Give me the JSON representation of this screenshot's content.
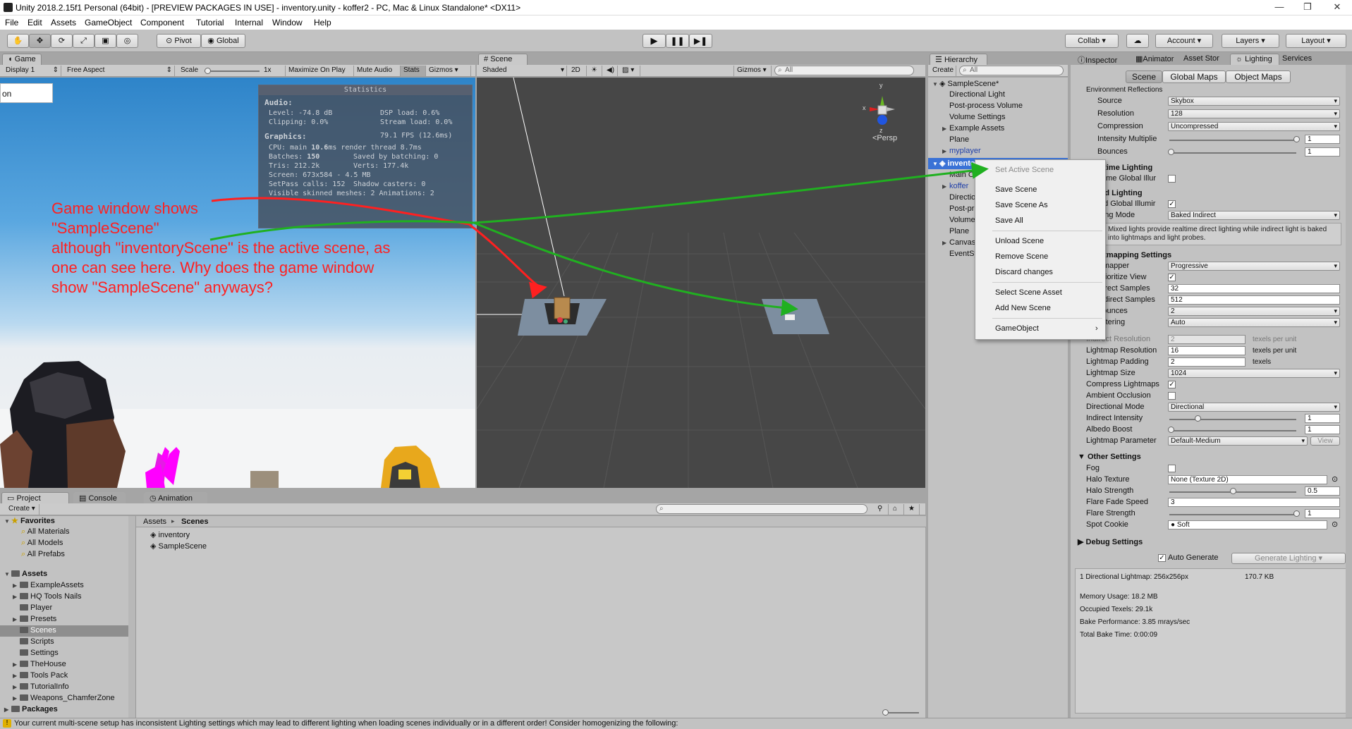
{
  "window": {
    "title": "Unity 2018.2.15f1 Personal (64bit) - [PREVIEW PACKAGES IN USE] - inventory.unity - koffer2 - PC, Mac & Linux Standalone* <DX11>",
    "minimize": "—",
    "maximize": "❐",
    "close": "✕"
  },
  "menu": [
    "File",
    "Edit",
    "Assets",
    "GameObject",
    "Component",
    "Tutorial",
    "Internal",
    "Window",
    "Help"
  ],
  "toolbar": {
    "pivot": "Pivot",
    "global": "Global",
    "collab": "Collab ▾",
    "account": "Account",
    "layers": "Layers",
    "layout": "Layout"
  },
  "game": {
    "tab": "Game",
    "display": "Display 1",
    "aspect": "Free Aspect",
    "scale_label": "Scale",
    "scale_value": "1x",
    "maximize": "Maximize On Play",
    "mute": "Mute Audio",
    "stats": "Stats",
    "gizmos": "Gizmos",
    "input_text": "on",
    "stats_title": "Statistics",
    "audio_header": "Audio:",
    "level": "Level: -74.8 dB",
    "dsp": "DSP load: 0.6%",
    "clipping": "Clipping: 0.0%",
    "stream": "Stream load: 0.0%",
    "graphics_header": "Graphics:",
    "fps": "79.1 FPS (12.6ms)",
    "cpu_prefix": "CPU: main ",
    "cpu_main": "10.6",
    "cpu_suffix": "ms  render thread 8.7ms",
    "batches_prefix": "Batches: ",
    "batches": "150",
    "saved": "Saved by batching: 0",
    "tris": "Tris: 212.2k",
    "verts": "Verts: 177.4k",
    "screen": "Screen: 673x584 - 4.5 MB",
    "setpass": "SetPass calls: 152",
    "shadow": "Shadow casters: 0",
    "visible": "Visible skinned meshes: 2   Animations: 2"
  },
  "annotation": {
    "line1": "Game window shows",
    "line2": "\"SampleScene\"",
    "line3": "although \"inventoryScene\" is the active scene, as",
    "line4": "one can see here. Why does the game window",
    "line5": "show \"SampleScene\" anyways?",
    "color": "#ff2020"
  },
  "scene": {
    "tab": "Scene",
    "shaded": "Shaded",
    "mode_2d": "2D",
    "gizmos": "Gizmos",
    "search": "All",
    "persp": "<Persp",
    "axis_y": "y",
    "axis_x": "x",
    "axis_z": "z"
  },
  "hierarchy": {
    "tab": "Hierarchy",
    "create": "Create",
    "search": "All",
    "sample_scene": "SampleScene*",
    "sample_items": [
      "Directional Light",
      "Post-process Volume",
      "Volume Settings",
      "Example Assets",
      "Plane",
      "myplayer"
    ],
    "inventory_scene": "inventoryScene",
    "inventory_items": [
      "Main Camera",
      "koffer",
      "Directional Light",
      "Post-process Volume",
      "Volume Settings",
      "Plane",
      "Canvas",
      "EventSystem"
    ]
  },
  "context_menu": {
    "items": [
      "Set Active Scene",
      "Save Scene",
      "Save Scene As",
      "Save All",
      "Unload Scene",
      "Remove Scene",
      "Discard changes",
      "Select Scene Asset",
      "Add New Scene",
      "GameObject"
    ]
  },
  "right_tabs": [
    "Inspector",
    "Animator",
    "Asset Stor",
    "Lighting",
    "Services"
  ],
  "lighting": {
    "subtabs": [
      "Scene",
      "Global Maps",
      "Object Maps"
    ],
    "env_reflections": "Environment Reflections",
    "source_label": "Source",
    "source_value": "Skybox",
    "resolution_label": "Resolution",
    "resolution_value": "128",
    "compression_label": "Compression",
    "compression_value": "Uncompressed",
    "intensity_mult_label": "Intensity Multiplie",
    "intensity_mult_value": "1",
    "bounces_label": "Bounces",
    "bounces_value": "1",
    "realtime_header": "Realtime Lighting",
    "realtime_gi_label": "Realtime Global Illur",
    "mixed_header": "Mixed Lighting",
    "baked_gi_label": "Baked Global Illumir",
    "lighting_mode_label": "Lighting Mode",
    "lighting_mode_value": "Baked Indirect",
    "mixed_help": "Mixed lights provide realtime direct lighting while indirect light is baked into lightmaps and light probes.",
    "lightmapping_header": "Lightmapping Settings",
    "lightmapper_label": "Lightmapper",
    "lightmapper_value": "Progressive",
    "prioritize_label": "Prioritize View",
    "direct_samples_label": "Direct Samples",
    "direct_samples_value": "32",
    "indirect_samples_label": "Indirect Samples",
    "indirect_samples_value": "512",
    "lm_bounces_label": "Bounces",
    "lm_bounces_value": "2",
    "filtering_label": "Filtering",
    "filtering_value": "Auto",
    "indirect_res_label": "Indirect Resolution",
    "indirect_res_value": "2",
    "indirect_res_unit": "texels per unit",
    "lm_res_label": "Lightmap Resolution",
    "lm_res_value": "16",
    "lm_res_unit": "texels per unit",
    "lm_padding_label": "Lightmap Padding",
    "lm_padding_value": "2",
    "lm_padding_unit": "texels",
    "lm_size_label": "Lightmap Size",
    "lm_size_value": "1024",
    "compress_label": "Compress Lightmaps",
    "ao_label": "Ambient Occlusion",
    "dir_mode_label": "Directional Mode",
    "dir_mode_value": "Directional",
    "indirect_intensity_label": "Indirect Intensity",
    "indirect_intensity_value": "1",
    "albedo_label": "Albedo Boost",
    "albedo_value": "1",
    "lm_param_label": "Lightmap Parameter",
    "lm_param_value": "Default-Medium",
    "lm_param_view": "View",
    "other_header": "Other Settings",
    "fog_label": "Fog",
    "halo_tex_label": "Halo Texture",
    "halo_tex_value": "None (Texture 2D)",
    "halo_strength_label": "Halo Strength",
    "halo_strength_value": "0.5",
    "flare_fade_label": "Flare Fade Speed",
    "flare_fade_value": "3",
    "flare_strength_label": "Flare Strength",
    "flare_strength_value": "1",
    "spot_cookie_label": "Spot Cookie",
    "spot_cookie_value": "Soft",
    "debug_header": "Debug Settings",
    "auto_generate": "Auto Generate",
    "generate_btn": "Generate Lighting",
    "info_lightmap": "1 Directional Lightmap: 256x256px",
    "info_size": "170.7 KB",
    "info_memory": "Memory Usage: 18.2 MB",
    "info_texels": "Occupied Texels: 29.1k",
    "info_bake_perf": "Bake Performance: 3.85 mrays/sec",
    "info_bake_time": "Total Bake Time: 0:00:09"
  },
  "project": {
    "tabs": [
      "Project",
      "Console",
      "Animation"
    ],
    "create": "Create",
    "favorites": "Favorites",
    "fav_items": [
      "All Materials",
      "All Models",
      "All Prefabs"
    ],
    "assets": "Assets",
    "asset_folders": [
      "ExampleAssets",
      "HQ Tools Nails",
      "Player",
      "Presets",
      "Scenes",
      "Scripts",
      "Settings",
      "TheHouse",
      "Tools Pack",
      "TutorialInfo",
      "Weapons_ChamferZone"
    ],
    "packages": "Packages",
    "breadcrumb_root": "Assets",
    "breadcrumb_sep": "▸",
    "breadcrumb_current": "Scenes",
    "files": [
      "inventory",
      "SampleScene"
    ]
  },
  "status": {
    "message": "Your current multi-scene setup has inconsistent Lighting settings which may lead to different lighting when loading scenes individually or in a different order! Consider homogenizing the following:"
  }
}
